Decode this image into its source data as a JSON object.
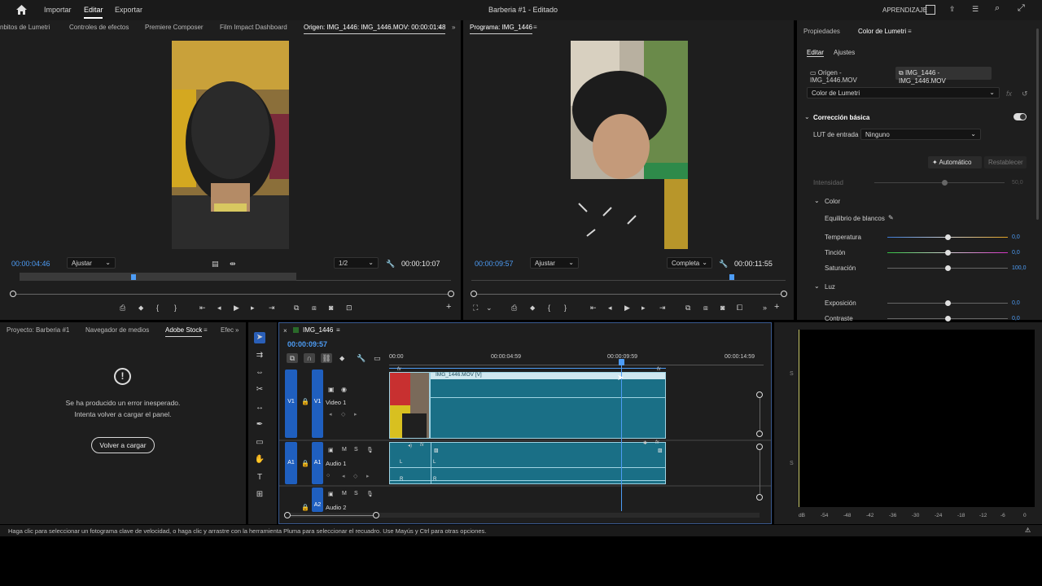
{
  "topbar": {
    "nav": [
      "Importar",
      "Editar",
      "Exportar"
    ],
    "title": "Barberia #1 - Editado",
    "workspace": "APRENDIZAJE"
  },
  "source_panel": {
    "tabs": [
      "nbitos de Lumetri",
      "Controles de efectos",
      "Premiere Composer",
      "Film Impact Dashboard",
      "Origen: IMG_1446: IMG_1446.MOV: 00:00:01:48"
    ],
    "timecode": "00:00:04:46",
    "fit": "Ajustar",
    "resolution": "1/2",
    "duration": "00:00:10:07"
  },
  "program_panel": {
    "tab": "Programa: IMG_1446",
    "timecode": "00:00:09:57",
    "fit": "Ajustar",
    "resolution": "Completa",
    "duration": "00:00:11:55"
  },
  "lumetri": {
    "tabs": [
      "Propiedades",
      "Color de Lumetri"
    ],
    "subtabs": [
      "Editar",
      "Ajustes"
    ],
    "source_clip": "Origen - IMG_1446.MOV",
    "seq_clip": "IMG_1446 - IMG_1446.MOV",
    "effect": "Color de Lumetri",
    "section": "Corrección básica",
    "lut_label": "LUT de entrada",
    "lut_value": "Ninguno",
    "auto": "Automático",
    "reset": "Restablecer",
    "intensity_label": "Intensidad",
    "intensity_value": "50,0",
    "color_section": "Color",
    "white_balance": "Equilibrio de blancos",
    "temperature": {
      "label": "Temperatura",
      "value": "0,0",
      "level": 0.5
    },
    "tint": {
      "label": "Tinción",
      "value": "0,0",
      "level": 0.5
    },
    "saturation": {
      "label": "Saturación",
      "value": "100,0",
      "level": 0.5
    },
    "light_section": "Luz",
    "exposure": {
      "label": "Exposición",
      "value": "0,0",
      "level": 0.5
    },
    "contrast": {
      "label": "Contraste",
      "value": "0,0",
      "level": 0.5
    }
  },
  "project_panel": {
    "tabs": [
      "Proyecto: Barberia #1",
      "Navegador de medios",
      "Adobe Stock",
      "Efec"
    ],
    "error_line1": "Se ha producido un error inesperado.",
    "error_line2": "Intenta volver a cargar el panel.",
    "reload": "Volver a cargar"
  },
  "timeline": {
    "tab": "IMG_1446",
    "timecode": "00:00:09:57",
    "ruler": [
      "00:00",
      "00:00:04:59",
      "00:00:09:59",
      "00:00:14:59"
    ],
    "clip_label": "IMG_1446.MOV [V]",
    "tracks": {
      "v1": "Video 1",
      "a1": "Audio 1",
      "a2": "Audio 2",
      "v1_src": "V1",
      "v1_tgt": "V1",
      "a1_src": "A1",
      "a1_tgt": "A1",
      "a2_tgt": "A2"
    }
  },
  "meter": {
    "scale": [
      "dB",
      "-54",
      "-48",
      "-42",
      "-36",
      "-30",
      "-24",
      "-18",
      "-12",
      "-6",
      "0"
    ],
    "s_label": "S"
  },
  "status": "Haga clic para seleccionar un fotograma clave de velocidad, o haga clic y arrastre con la herramienta Pluma para seleccionar el recuadro. Use Mayús y Ctrl para otras opciones.",
  "colors": {
    "accent_blue": "#4d9cf5",
    "clip_teal": "#1a6f86",
    "track_blue": "#1f5fbf"
  }
}
